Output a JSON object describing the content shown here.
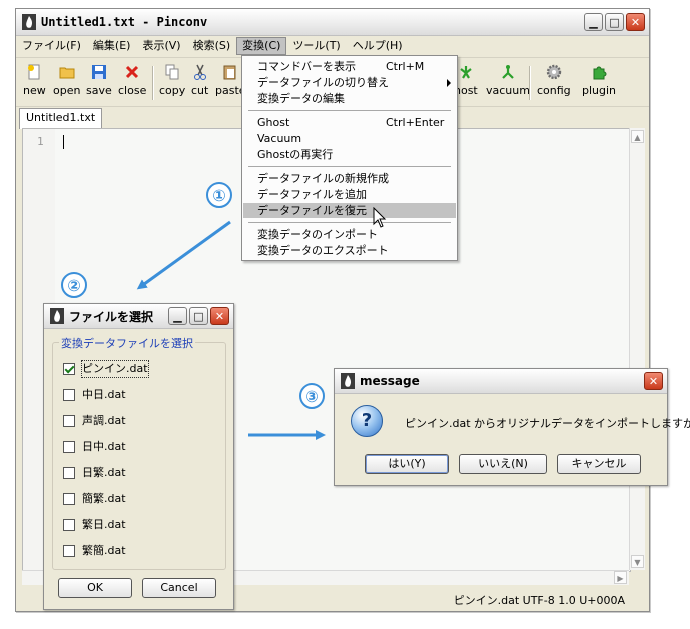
{
  "window": {
    "title": "Untitled1.txt - Pinconv",
    "menus": [
      "ファイル(F)",
      "編集(E)",
      "表示(V)",
      "検索(S)",
      "変換(C)",
      "ツール(T)",
      "ヘルプ(H)"
    ],
    "toolbar": [
      {
        "label": "new",
        "icon": "new-file-icon"
      },
      {
        "label": "open",
        "icon": "folder-open-icon"
      },
      {
        "label": "save",
        "icon": "floppy-save-icon"
      },
      {
        "label": "close",
        "icon": "red-x-close-icon"
      },
      {
        "label": "copy",
        "icon": "copy-icon"
      },
      {
        "label": "cut",
        "icon": "scissors-icon"
      },
      {
        "label": "paste",
        "icon": "clipboard-paste-icon"
      },
      {
        "label": "ghost",
        "icon": "ghost-icon"
      },
      {
        "label": "vacuum",
        "icon": "vacuum-icon"
      },
      {
        "label": "config",
        "icon": "gear-icon"
      },
      {
        "label": "plugin",
        "icon": "puzzle-plugin-icon"
      }
    ],
    "toolbar_visible": {
      "paste": "paste",
      "ghost": "host"
    },
    "tab": "Untitled1.txt",
    "line_number": "1",
    "status": "ピンイン.dat  UTF-8  1.0  U+000A"
  },
  "dropdown": {
    "groups": [
      [
        {
          "label": "コマンドバーを表示",
          "shortcut": "Ctrl+M"
        },
        {
          "label": "データファイルの切り替え",
          "shortcut": "",
          "submenu": true
        },
        {
          "label": "変換データの編集",
          "shortcut": ""
        }
      ],
      [
        {
          "label": "Ghost",
          "shortcut": "Ctrl+Enter"
        },
        {
          "label": "Vacuum",
          "shortcut": ""
        },
        {
          "label": "Ghostの再実行",
          "shortcut": ""
        }
      ],
      [
        {
          "label": "データファイルの新規作成",
          "shortcut": ""
        },
        {
          "label": "データファイルを追加",
          "shortcut": ""
        },
        {
          "label": "データファイルを復元",
          "shortcut": "",
          "highlighted": true
        }
      ],
      [
        {
          "label": "変換データのインポート",
          "shortcut": ""
        },
        {
          "label": "変換データのエクスポート",
          "shortcut": ""
        }
      ]
    ]
  },
  "annotations": {
    "one": "①",
    "two": "②",
    "three": "③",
    "accent": "#3b8fd9"
  },
  "file_dialog": {
    "title": "ファイルを選択",
    "group_label": "変換データファイルを選択",
    "files": [
      {
        "name": "ピンイン.dat",
        "checked": true
      },
      {
        "name": "中日.dat",
        "checked": false
      },
      {
        "name": "声調.dat",
        "checked": false
      },
      {
        "name": "日中.dat",
        "checked": false
      },
      {
        "name": "日繁.dat",
        "checked": false
      },
      {
        "name": "簡繁.dat",
        "checked": false
      },
      {
        "name": "繁日.dat",
        "checked": false
      },
      {
        "name": "繁簡.dat",
        "checked": false
      }
    ],
    "ok": "OK",
    "cancel": "Cancel"
  },
  "message_dialog": {
    "title": "message",
    "text": "ピンイン.dat からオリジナルデータをインポートしますか？",
    "buttons": [
      "はい(Y)",
      "いいえ(N)",
      "キャンセル"
    ]
  }
}
